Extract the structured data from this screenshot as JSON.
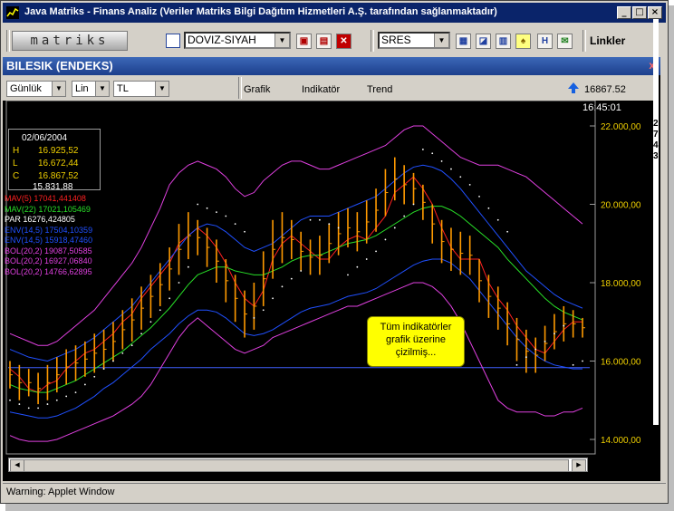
{
  "window": {
    "title": "Java Matriks - Finans Analiz (Veriler Matriks Bilgi Dağıtım Hizmetleri A.Ş. tarafından sağlanmaktadır)"
  },
  "toolbar": {
    "logo": "matriks",
    "theme_select": "DOVIZ-SIYAH",
    "symbol_select": "SRES",
    "links": "Linkler"
  },
  "panel": {
    "title": "BILESIK (ENDEKS)",
    "close": "x",
    "period": "Günlük",
    "scale": "Lin",
    "currency": "TL",
    "menus": [
      "Grafik",
      "Indikatör",
      "Trend"
    ],
    "price": "16867.52",
    "time": "16:45:01"
  },
  "side_digits": [
    "2",
    "7",
    "4",
    "3"
  ],
  "legend": {
    "date": "02/06/2004",
    "h_label": "H",
    "h": "16.925,52",
    "l_label": "L",
    "l": "16.672,44",
    "c_label": "C",
    "c": "16.867,52",
    "last": "15.831,88"
  },
  "indicators": [
    {
      "text": "MAV(5) 17041,441408",
      "color": "#ff2020"
    },
    {
      "text": "MAV(22) 17021,105469",
      "color": "#28e028"
    },
    {
      "text": "PAR 16276,424805",
      "color": "#ffffff"
    },
    {
      "text": "ENV(14,5) 17504,10359",
      "color": "#2050ff"
    },
    {
      "text": "ENV(14,5) 15918,47460",
      "color": "#2050ff"
    },
    {
      "text": "BOL(20,2) 19087,50585",
      "color": "#e040e0"
    },
    {
      "text": "BOL(20,2) 16927,06840",
      "color": "#e040e0"
    },
    {
      "text": "BOL(20,2) 14766,62895",
      "color": "#e040e0"
    }
  ],
  "note": {
    "text": "Tüm indikatörler grafik üzerine çizilmiş..."
  },
  "status": "Warning: Applet Window",
  "chart_data": {
    "type": "line",
    "y_ticks": [
      "22.000,00",
      "20.000,00",
      "18.000,00",
      "16.000,00",
      "14.000,00"
    ],
    "ylim": [
      14000,
      22000
    ],
    "series": [
      {
        "name": "MAV(5)",
        "color": "#ff2020",
        "values": [
          15800,
          15600,
          15300,
          15200,
          15400,
          15500,
          15800,
          16000,
          16200,
          16300,
          16500,
          16700,
          17000,
          17200,
          17600,
          17900,
          18200,
          18500,
          19000,
          19200,
          19400,
          19200,
          18900,
          18500,
          18000,
          17600,
          17400,
          17800,
          18600,
          19000,
          19200,
          19000,
          18800,
          18600,
          18600,
          18900,
          19100,
          19200,
          19100,
          19400,
          19700,
          20300,
          20500,
          20700,
          20400,
          20000,
          19400,
          18900,
          18600,
          18600,
          18600,
          18000,
          17600,
          17300,
          16900,
          16600,
          16300,
          16200,
          16500,
          16800,
          17000,
          17000
        ]
      },
      {
        "name": "MAV(22)",
        "color": "#28e028",
        "values": [
          15400,
          15300,
          15250,
          15200,
          15200,
          15300,
          15400,
          15500,
          15650,
          15800,
          15950,
          16100,
          16250,
          16450,
          16650,
          16850,
          17100,
          17350,
          17650,
          17950,
          18200,
          18300,
          18400,
          18400,
          18300,
          18250,
          18200,
          18200,
          18300,
          18400,
          18550,
          18650,
          18700,
          18700,
          18800,
          18900,
          19000,
          19050,
          19100,
          19200,
          19350,
          19500,
          19650,
          19800,
          19900,
          19950,
          19950,
          19850,
          19700,
          19500,
          19300,
          19100,
          18900,
          18600,
          18350,
          18100,
          17850,
          17600,
          17400,
          17250,
          17150,
          17050
        ]
      },
      {
        "name": "ENV(14,5)",
        "color": "#2050ff",
        "values": [
          16300,
          16200,
          16100,
          16050,
          16000,
          16100,
          16200,
          16300,
          16450,
          16600,
          16800,
          17000,
          17200,
          17400,
          17700,
          18000,
          18300,
          18600,
          18900,
          19200,
          19400,
          19500,
          19450,
          19300,
          19100,
          18900,
          18800,
          18900,
          19000,
          19200,
          19400,
          19600,
          19700,
          19700,
          19700,
          19800,
          19900,
          20000,
          20100,
          20200,
          20400,
          20600,
          20800,
          20950,
          21000,
          20950,
          20850,
          20650,
          20400,
          20100,
          19800,
          19500,
          19200,
          18900,
          18600,
          18300,
          18100,
          17900,
          17700,
          17550,
          17450,
          17350
        ]
      },
      {
        "name": "ENV(14,5)",
        "color": "#2050ff",
        "values": [
          14700,
          14650,
          14600,
          14550,
          14550,
          14600,
          14700,
          14800,
          14950,
          15100,
          15300,
          15450,
          15650,
          15850,
          16050,
          16300,
          16500,
          16700,
          16950,
          17150,
          17300,
          17300,
          17250,
          17100,
          16900,
          16700,
          16650,
          16700,
          16800,
          16950,
          17100,
          17250,
          17350,
          17400,
          17450,
          17550,
          17650,
          17700,
          17750,
          17850,
          18000,
          18150,
          18300,
          18450,
          18550,
          18600,
          18600,
          18500,
          18300,
          18100,
          17800,
          17500,
          17200,
          16900,
          16600,
          16350,
          16150,
          16000,
          15900,
          15850,
          15800,
          15800
        ]
      },
      {
        "name": "BOL(20,2)",
        "color": "#e040e0",
        "values": [
          16700,
          16600,
          16500,
          16400,
          16400,
          16500,
          16700,
          16900,
          17100,
          17300,
          17600,
          17900,
          18200,
          18500,
          18900,
          19400,
          19900,
          20500,
          20800,
          21000,
          21100,
          21000,
          20900,
          20700,
          20400,
          20200,
          20300,
          20600,
          20800,
          21000,
          21100,
          21100,
          21000,
          20900,
          20900,
          21000,
          21100,
          21200,
          21300,
          21400,
          21500,
          21700,
          21900,
          22000,
          22000,
          21800,
          21600,
          21400,
          21200,
          21100,
          21000,
          21000,
          21000,
          20900,
          20800,
          20700,
          20500,
          20300,
          20100,
          19900,
          19700,
          19500
        ]
      },
      {
        "name": "BOL(20,2)",
        "color": "#e040e0",
        "values": [
          14100,
          14000,
          13950,
          13950,
          13950,
          14000,
          14100,
          14200,
          14300,
          14400,
          14500,
          14600,
          14750,
          14900,
          15100,
          15400,
          15800,
          16200,
          16600,
          16900,
          17100,
          16900,
          16700,
          16500,
          16300,
          16200,
          16300,
          16400,
          16600,
          16700,
          16800,
          16900,
          17000,
          17100,
          17200,
          17300,
          17400,
          17400,
          17500,
          17600,
          17700,
          17800,
          17900,
          18000,
          18000,
          17900,
          17700,
          17400,
          17000,
          16500,
          16000,
          15500,
          15000,
          14800,
          14700,
          14700,
          14700,
          14600,
          14600,
          14700,
          14700,
          14800
        ]
      }
    ],
    "bars": [
      {
        "low": 15300,
        "high": 16000
      },
      {
        "low": 15000,
        "high": 15900
      },
      {
        "low": 15100,
        "high": 15800
      },
      {
        "low": 14900,
        "high": 15700
      },
      {
        "low": 15000,
        "high": 15900
      },
      {
        "low": 15200,
        "high": 16100
      },
      {
        "low": 15400,
        "high": 16300
      },
      {
        "low": 15500,
        "high": 16400
      },
      {
        "low": 15600,
        "high": 16500
      },
      {
        "low": 15700,
        "high": 16700
      },
      {
        "low": 15800,
        "high": 16800
      },
      {
        "low": 16000,
        "high": 17000
      },
      {
        "low": 16300,
        "high": 17300
      },
      {
        "low": 16500,
        "high": 17600
      },
      {
        "low": 16800,
        "high": 17900
      },
      {
        "low": 17100,
        "high": 18200
      },
      {
        "low": 17400,
        "high": 18500
      },
      {
        "low": 17800,
        "high": 18900
      },
      {
        "low": 18200,
        "high": 19500
      },
      {
        "low": 18600,
        "high": 19800
      },
      {
        "low": 18700,
        "high": 19600
      },
      {
        "low": 18400,
        "high": 19400
      },
      {
        "low": 18000,
        "high": 19100
      },
      {
        "low": 17500,
        "high": 18600
      },
      {
        "low": 17000,
        "high": 18200
      },
      {
        "low": 16600,
        "high": 17800
      },
      {
        "low": 16800,
        "high": 18000
      },
      {
        "low": 17400,
        "high": 18800
      },
      {
        "low": 18100,
        "high": 19600
      },
      {
        "low": 18500,
        "high": 19800
      },
      {
        "low": 18600,
        "high": 19600
      },
      {
        "low": 18300,
        "high": 19300
      },
      {
        "low": 18200,
        "high": 19100
      },
      {
        "low": 18200,
        "high": 19200
      },
      {
        "low": 18500,
        "high": 19500
      },
      {
        "low": 18700,
        "high": 19800
      },
      {
        "low": 18900,
        "high": 19900
      },
      {
        "low": 18800,
        "high": 19800
      },
      {
        "low": 19000,
        "high": 20100
      },
      {
        "low": 19300,
        "high": 20400
      },
      {
        "low": 19700,
        "high": 20900
      },
      {
        "low": 20100,
        "high": 21200
      },
      {
        "low": 20000,
        "high": 21000
      },
      {
        "low": 20000,
        "high": 20800
      },
      {
        "low": 19600,
        "high": 20500
      },
      {
        "low": 19000,
        "high": 20000
      },
      {
        "low": 18500,
        "high": 19600
      },
      {
        "low": 18300,
        "high": 19400
      },
      {
        "low": 18200,
        "high": 19300
      },
      {
        "low": 18200,
        "high": 19200
      },
      {
        "low": 17500,
        "high": 18600
      },
      {
        "low": 17100,
        "high": 18200
      },
      {
        "low": 16800,
        "high": 17900
      },
      {
        "low": 16400,
        "high": 17500
      },
      {
        "low": 16000,
        "high": 17100
      },
      {
        "low": 15700,
        "high": 16800
      },
      {
        "low": 15700,
        "high": 16600
      },
      {
        "low": 16000,
        "high": 16900
      },
      {
        "low": 16300,
        "high": 17200
      },
      {
        "low": 16500,
        "high": 17400
      },
      {
        "low": 16600,
        "high": 17300
      },
      {
        "low": 16600,
        "high": 17100
      }
    ],
    "par": [
      15000,
      14900,
      14800,
      14800,
      14900,
      15000,
      15100,
      15200,
      15400,
      15600,
      15800,
      16000,
      16200,
      16400,
      16700,
      17000,
      17300,
      17600,
      18000,
      18400,
      20000,
      19900,
      19800,
      19700,
      19500,
      19300,
      17100,
      17300,
      17600,
      17900,
      18100,
      18300,
      19600,
      19600,
      19500,
      19400,
      18200,
      18400,
      18600,
      18800,
      19100,
      19400,
      19700,
      20000,
      21400,
      21300,
      21100,
      20900,
      20700,
      20500,
      20200,
      19900,
      19600,
      19300,
      15900,
      16100,
      16300,
      16500,
      16700,
      16900,
      15900,
      16000
    ],
    "hline": 15831.88
  }
}
